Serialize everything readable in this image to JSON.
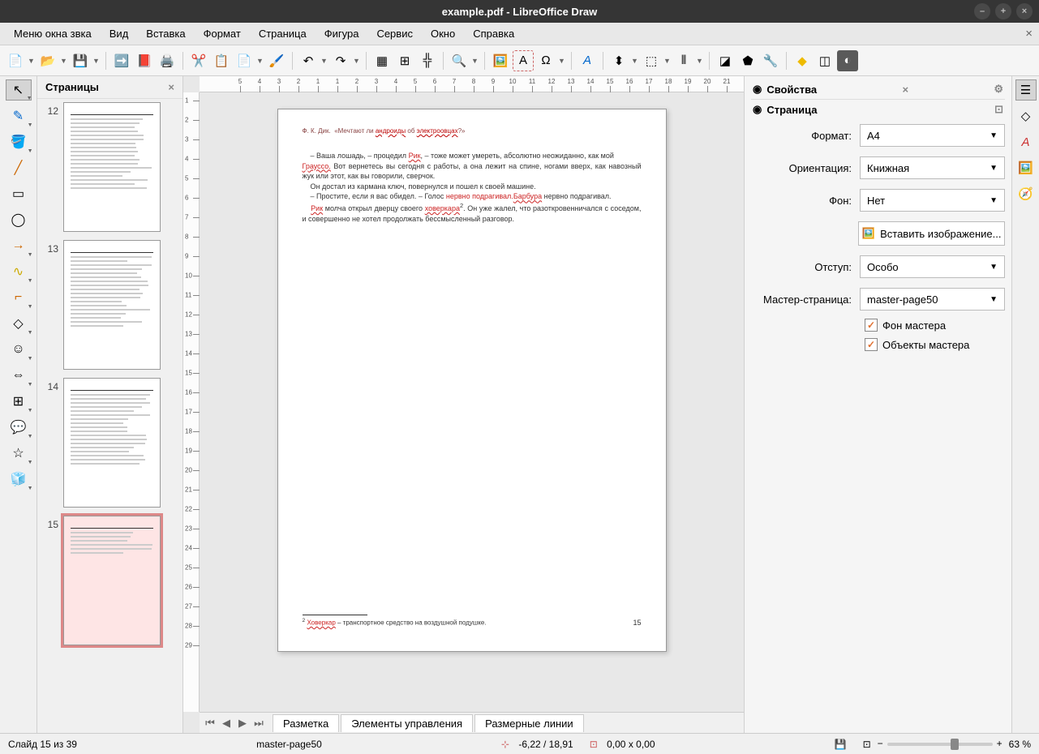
{
  "titlebar": {
    "title": "example.pdf - LibreOffice Draw"
  },
  "menubar": {
    "items": [
      "Меню окна звка",
      "Вид",
      "Вставка",
      "Формат",
      "Страница",
      "Фигура",
      "Сервис",
      "Окно",
      "Справка"
    ]
  },
  "pages_panel": {
    "title": "Страницы",
    "thumbs": [
      {
        "num": "12",
        "sel": false,
        "lines": 18
      },
      {
        "num": "13",
        "sel": false,
        "lines": 18
      },
      {
        "num": "14",
        "sel": false,
        "lines": 18
      },
      {
        "num": "15",
        "sel": true,
        "lines": 6
      }
    ]
  },
  "sidebar": {
    "title": "Свойства",
    "section": "Страница",
    "format_label": "Формат:",
    "format_value": "A4",
    "orient_label": "Ориентация:",
    "orient_value": "Книжная",
    "bg_label": "Фон:",
    "bg_value": "Нет",
    "insert_image": "Вставить изображение...",
    "margin_label": "Отступ:",
    "margin_value": "Особо",
    "master_label": "Мастер-страница:",
    "master_value": "master-page50",
    "cb1": "Фон мастера",
    "cb2": "Объекты мастера"
  },
  "bottom_tabs": {
    "tabs": [
      "Разметка",
      "Элементы управления",
      "Размерные линии"
    ]
  },
  "statusbar": {
    "slide": "Слайд 15 из 39",
    "master": "master-page50",
    "coords": "-6,22 / 18,91",
    "size": "0,00 x 0,00",
    "zoom": "63 %"
  },
  "page_content": {
    "header": "Ф. К. Дик. «Мечтают ли андроиды об электроовцах?»",
    "para1_a": "– Ваша лошадь, – процедил ",
    "para1_b": ", – тоже может умереть, абсолютно неожиданно, как мой",
    "para1_w1": "Рик",
    "para2_a": "Грауссо.",
    "para2_b": " Вот вернетесь вы сегодня с работы, а она лежит на спине, ногами вверх, как навозный жук или этот, как вы говорили, сверчок.",
    "para3": "Он достал из кармана ключ, повернулся и пошел к своей машине.",
    "para4_a": "– Простите, если я вас обидел. – Голос ",
    "para4_b": " нервно подрагивал.",
    "para4_w1": "Барбура",
    "para5_a": "Рик",
    "para5_b": " молча открыл дверцу своего ",
    "para5_c": "ховеркара",
    "para5_d": ". Он уже жалел, что разоткровенничался с соседом, и совершенно не хотел продолжать бессмысленный разговор.",
    "footnote_sup": "2",
    "footnote_w": "Ховеркар",
    "footnote_t": " – транспортное средство на воздушной подушке.",
    "pagenum": "15"
  },
  "ruler_h": [
    -5,
    -4,
    -3,
    -2,
    -1,
    1,
    2,
    3,
    4,
    5,
    6,
    7,
    8,
    9,
    10,
    11,
    12,
    13,
    14,
    15,
    16,
    17,
    18,
    19,
    20,
    21
  ],
  "ruler_v": [
    1,
    2,
    3,
    4,
    5,
    6,
    7,
    8,
    9,
    10,
    11,
    12,
    13,
    14,
    15,
    16,
    17,
    18,
    19,
    20,
    21,
    22,
    23,
    24,
    25,
    26,
    27,
    28,
    29
  ]
}
